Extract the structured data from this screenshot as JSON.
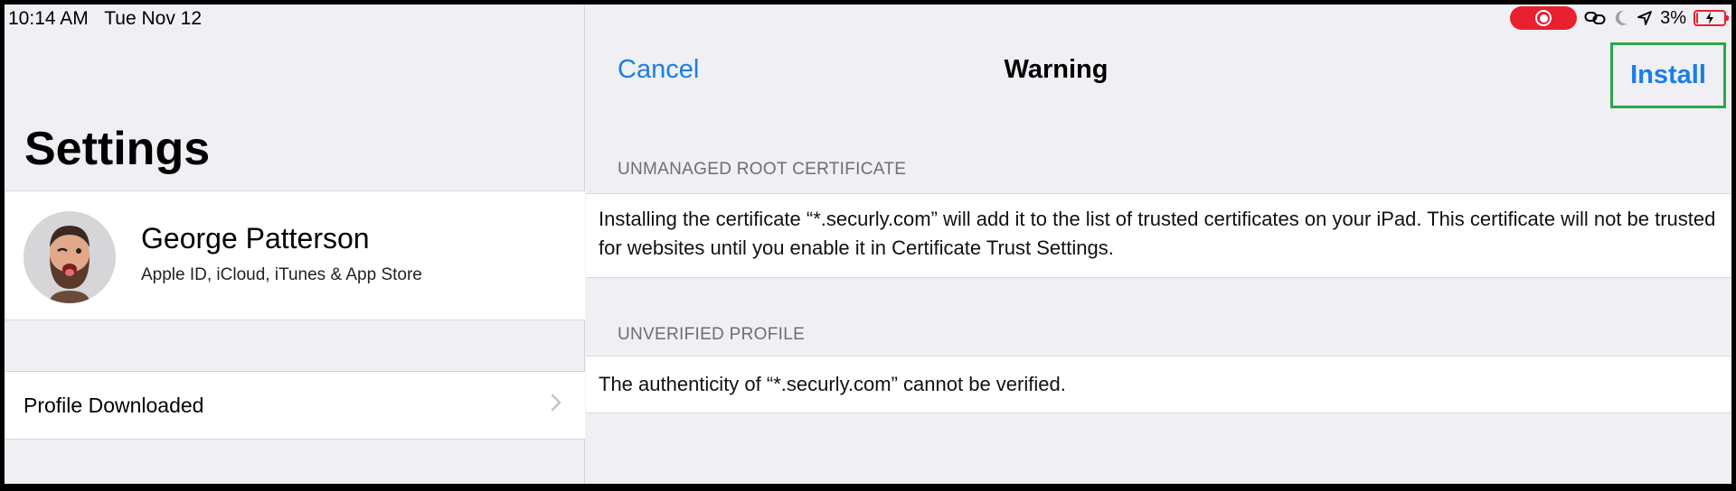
{
  "status_bar": {
    "time": "10:14 AM",
    "date": "Tue Nov 12",
    "battery_percent": "3%",
    "battery_level": 0.03,
    "recording_color": "#e8202f"
  },
  "settings": {
    "title": "Settings",
    "profile": {
      "name": "George Patterson",
      "subtitle": "Apple ID, iCloud, iTunes & App Store"
    },
    "profile_downloaded": "Profile Downloaded"
  },
  "dialog": {
    "cancel_label": "Cancel",
    "title": "Warning",
    "install_label": "Install",
    "sections": [
      {
        "header": "UNMANAGED ROOT CERTIFICATE",
        "body": "Installing the certificate “*.securly.com” will add it to the list of trusted certificates on your iPad. This certificate will not be trusted for websites until you enable it in Certificate Trust Settings."
      },
      {
        "header": "UNVERIFIED PROFILE",
        "body": "The authenticity of “*.securly.com” cannot be verified."
      }
    ]
  },
  "colors": {
    "accent": "#1a7ee8",
    "highlight_box": "#2ca64a",
    "background": "#efeff4"
  },
  "icons": [
    "screen-recording-icon",
    "link-icon",
    "moon-icon",
    "location-arrow-icon",
    "battery-charging-icon",
    "chevron-right-icon"
  ]
}
